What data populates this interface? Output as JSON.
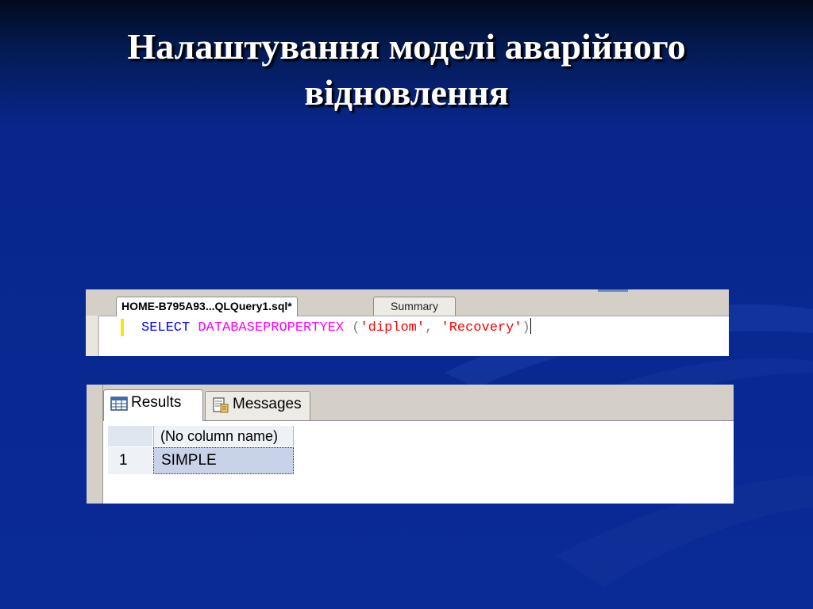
{
  "slide": {
    "title_line1": "Налаштування моделі аварійного",
    "title_line2": "відновлення"
  },
  "editor": {
    "tabs": [
      {
        "label": "HOME-B795A93...QLQuery1.sql*",
        "active": true
      },
      {
        "label": "Summary",
        "active": false
      }
    ],
    "code": {
      "keyword": "SELECT",
      "function": "DATABASEPROPERTYEX",
      "open_paren": "(",
      "arg1": "'diplom'",
      "comma": ",",
      "arg2": "'Recovery'",
      "close_paren": ")"
    }
  },
  "results": {
    "tabs": [
      {
        "label": "Results",
        "icon": "grid-icon",
        "active": true
      },
      {
        "label": "Messages",
        "icon": "messages-icon",
        "active": false
      }
    ],
    "columns": [
      "(No column name)"
    ],
    "rows": [
      {
        "num": "1",
        "values": [
          "SIMPLE"
        ]
      }
    ]
  },
  "colors": {
    "background": "#0a2a96",
    "keyword": "#0000ff",
    "function": "#ff00ff",
    "string": "#ff0000",
    "selected_cell": "#c8d3ea"
  }
}
